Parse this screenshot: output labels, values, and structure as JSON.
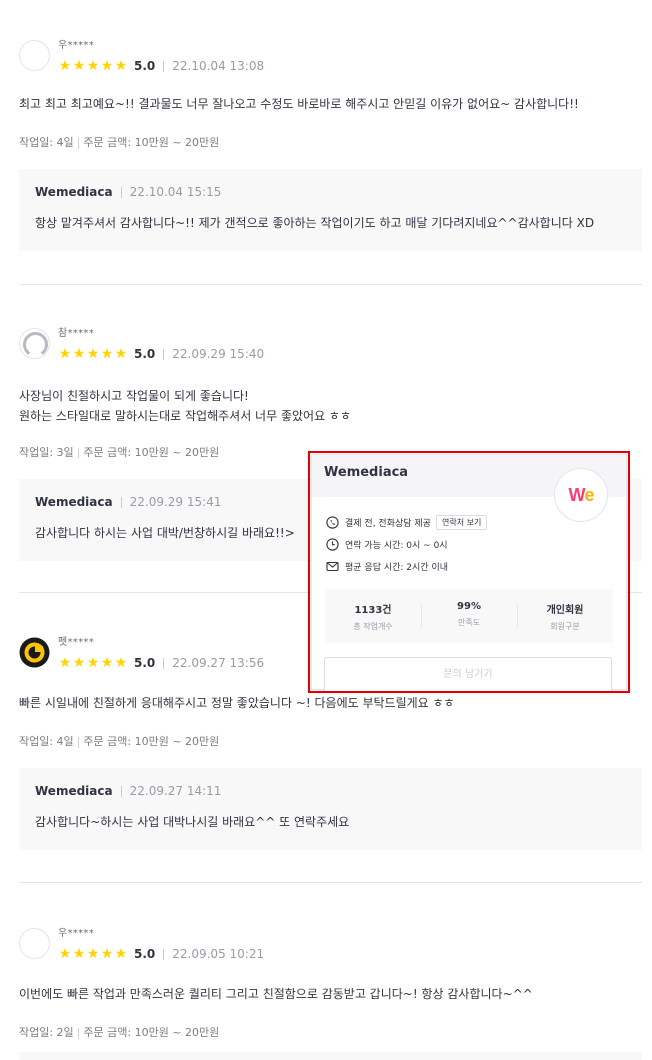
{
  "reviews": [
    {
      "nickname": "우*****",
      "score": "5.0",
      "date": "22.10.04 13:08",
      "content": [
        "최고 최고 최고예요~!! 결과물도 너무 잘나오고 수정도 바로바로 해주시고 안믿길 이유가 없어요~ 감사합니다!!"
      ],
      "meta_days": "작업일: 4일",
      "meta_price": "주문 금액: 10만원 ~ 20만원",
      "reply": {
        "name": "Wemediaca",
        "date": "22.10.04 15:15",
        "text": "항상 맡겨주셔서 감사합니다~!! 제가 갠적으로 좋아하는 작업이기도 하고 매달 기다려지네요^^감사합니다 XD"
      }
    },
    {
      "nickname": "참*****",
      "score": "5.0",
      "date": "22.09.29 15:40",
      "content": [
        "사장님이 친절하시고 작업물이 되게 좋습니다!",
        "원하는 스타일대로 말하시는대로 작업해주셔서 너무 좋았어요 ㅎㅎ"
      ],
      "meta_days": "작업일: 3일",
      "meta_price": "주문 금액: 10만원 ~ 20만원",
      "reply": {
        "name": "Wemediaca",
        "date": "22.09.29 15:41",
        "text": "감사합니다 하시는 사업 대박/번창하시길 바래요!!>"
      }
    },
    {
      "nickname": "펫*****",
      "score": "5.0",
      "date": "22.09.27 13:56",
      "content": [
        "빠른 시일내에 친절하게 응대해주시고  정말 좋았습니다 ~! 다음에도 부탁드릴게요 ㅎㅎ"
      ],
      "meta_days": "작업일: 4일",
      "meta_price": "주문 금액: 10만원 ~ 20만원",
      "reply": {
        "name": "Wemediaca",
        "date": "22.09.27 14:11",
        "text": "감사합니다~하시는 사업 대박나시길 바래요^^ 또 연락주세요"
      }
    },
    {
      "nickname": "우*****",
      "score": "5.0",
      "date": "22.09.05 10:21",
      "content": [
        "이번에도 빠른 작업과 만족스러운 퀄리티 그리고 친절함으로 감동받고 갑니다~! 항상 감사합니다~^^"
      ],
      "meta_days": "작업일: 2일",
      "meta_price": "주문 금액: 10만원 ~ 20만원"
    }
  ],
  "card": {
    "title": "Wemediaca",
    "logo_text_w": "W",
    "logo_text_e": "e",
    "payment_info": "결제 전, 전화상담 제공",
    "contact_pill": "연락처 보기",
    "contact_hours": "연락 가능 시간: 0시 ~ 0시",
    "response_time": "평균 응답 시간: 2시간 이내",
    "stats": [
      {
        "value": "1133건",
        "label": "총 작업개수"
      },
      {
        "value": "99%",
        "label": "만족도"
      },
      {
        "value": "개인회원",
        "label": "회원구분"
      }
    ],
    "contact_button": "문의 남기기"
  },
  "colors": {
    "star": "#ffd400",
    "highlight": "#e00000",
    "logo_gradient_a": "#ff3d6e",
    "logo_gradient_b": "#ffb300"
  }
}
